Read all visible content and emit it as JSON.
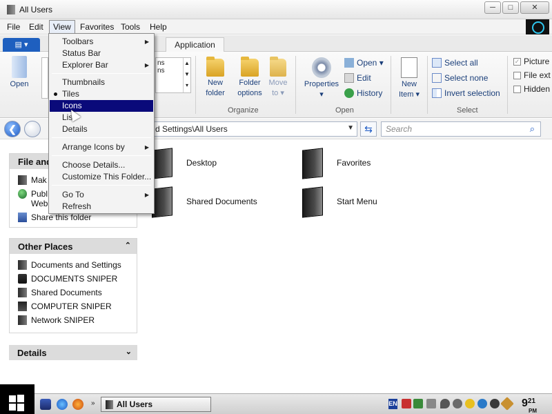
{
  "window": {
    "title": "All Users"
  },
  "window_buttons": {
    "minimize": "─",
    "maximize": "□",
    "close": "✕"
  },
  "menubar": [
    "File",
    "Edit",
    "View",
    "Favorites",
    "Tools",
    "Help"
  ],
  "ribbon": {
    "file_tab": "▤ ▾",
    "active_tab": "Application",
    "open_label": "Open",
    "partial_gallery": [
      "ns",
      "ns"
    ],
    "new_folder": "New folder",
    "folder_options": "Folder options",
    "move_to": "Move to ▾",
    "organize_label": "Organize",
    "properties": "Properties ▾",
    "open_small": "Open ▾",
    "edit_small": "Edit",
    "history_small": "History",
    "open_group_label": "Open",
    "new_item": "New Item ▾",
    "select_all": "Select all",
    "select_none": "Select none",
    "invert_selection": "Invert selection",
    "select_group_label": "Select",
    "check_pictures": "Picture",
    "check_file_ext": "File ext",
    "check_hidden": "Hidden"
  },
  "address": {
    "path": "d Settings\\All Users",
    "search_placeholder": "Search"
  },
  "task_pane": {
    "file_tasks": {
      "title": "File and",
      "items": [
        "Mak",
        "Publ Web",
        "Share this folder"
      ]
    },
    "other_places": {
      "title": "Other Places",
      "items": [
        "Documents and Settings",
        "DOCUMENTS SNIPER",
        "Shared Documents",
        "COMPUTER SNIPER",
        "Network SNIPER"
      ]
    },
    "details": {
      "title": "Details"
    }
  },
  "content": {
    "items": [
      "Desktop",
      "Favorites",
      "Shared Documents",
      "Start Menu"
    ]
  },
  "view_menu": {
    "items": [
      {
        "label": "Toolbars",
        "submenu": true
      },
      {
        "label": "Status Bar"
      },
      {
        "label": "Explorer Bar",
        "submenu": true
      },
      {
        "label": "Thumbnails"
      },
      {
        "label": "Tiles",
        "checked": true
      },
      {
        "label": "Icons",
        "highlighted": true
      },
      {
        "label": "List"
      },
      {
        "label": "Details"
      },
      {
        "label": "Arrange Icons by",
        "submenu": true
      },
      {
        "label": "Choose Details..."
      },
      {
        "label": "Customize This Folder..."
      },
      {
        "label": "Go To",
        "submenu": true
      },
      {
        "label": "Refresh"
      }
    ]
  },
  "taskbar": {
    "task_label": "All Users",
    "lang": "EN",
    "clock_hour": "9",
    "clock_min": "21",
    "clock_ampm": "PM"
  }
}
